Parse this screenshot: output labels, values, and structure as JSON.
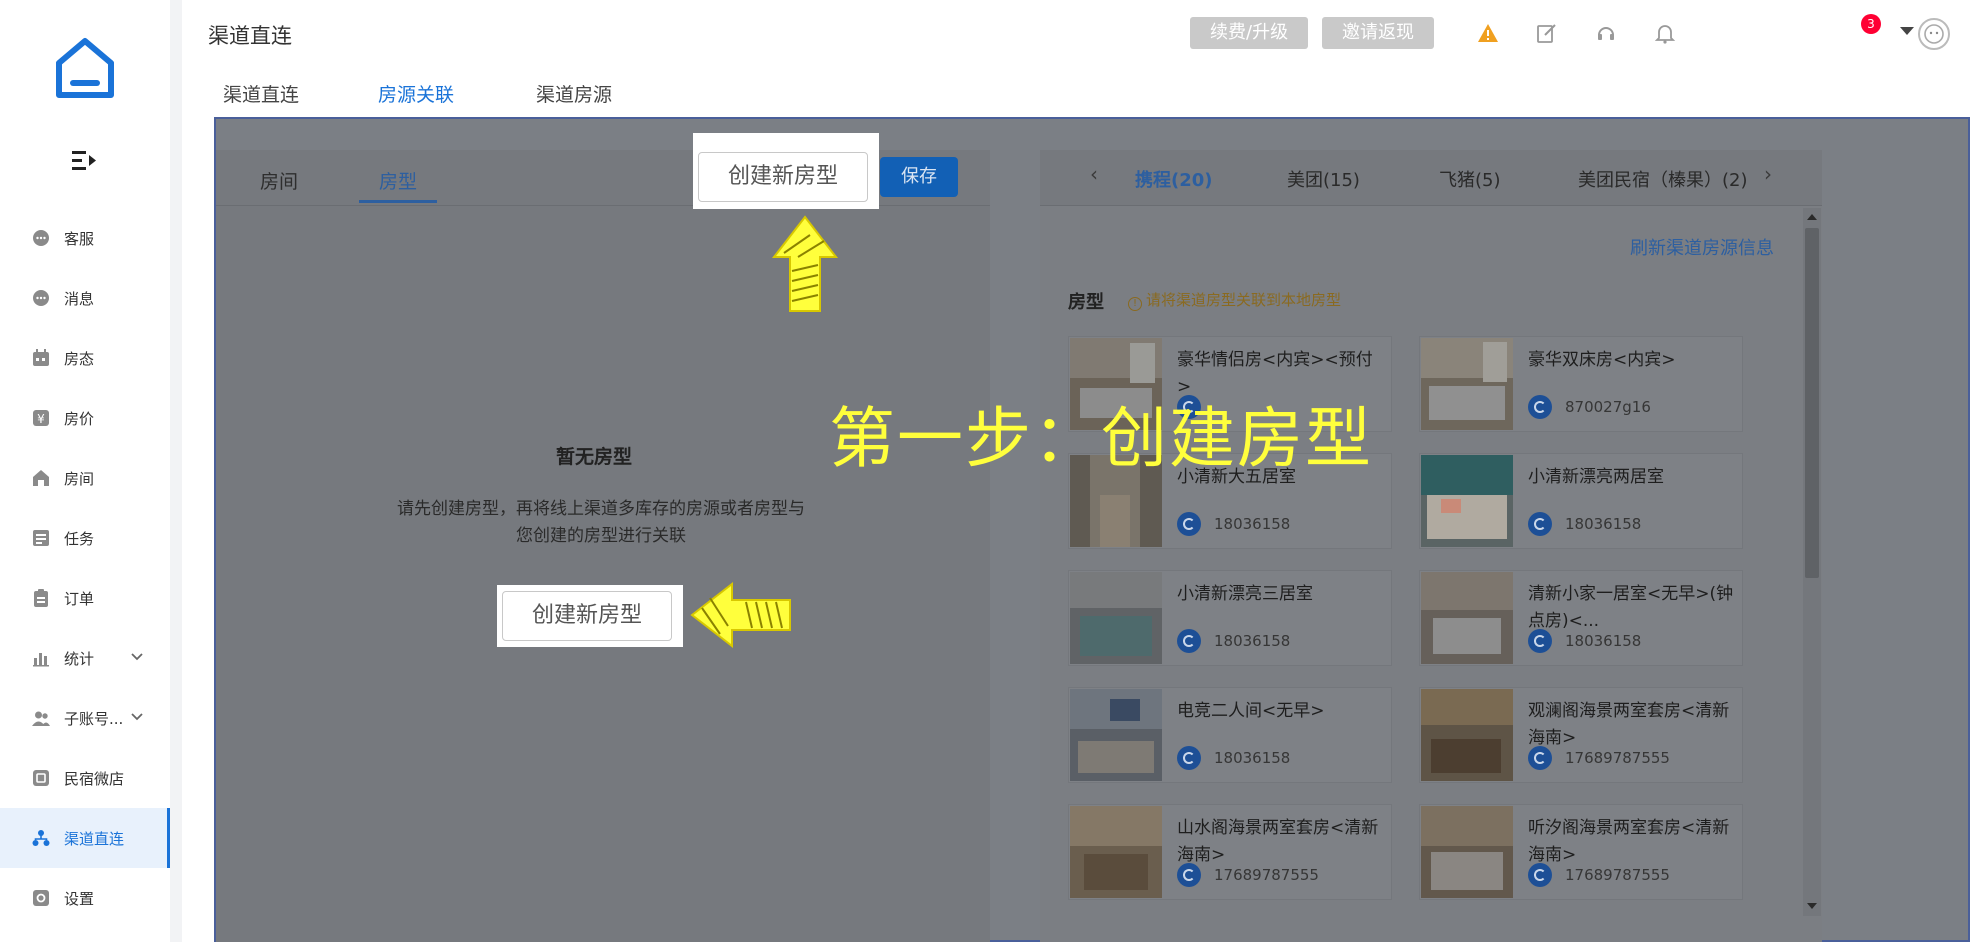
{
  "header": {
    "title": "渠道直连",
    "tabs": [
      {
        "label": "渠道直连",
        "active": false
      },
      {
        "label": "房源关联",
        "active": true
      },
      {
        "label": "渠道房源",
        "active": false
      }
    ],
    "renew_label": "续费/升级",
    "invite_label": "邀请返现",
    "notification_count": "3"
  },
  "sidebar": {
    "items": [
      {
        "label": "客服",
        "icon": "chat-icon"
      },
      {
        "label": "消息",
        "icon": "message-icon"
      },
      {
        "label": "房态",
        "icon": "calendar-icon"
      },
      {
        "label": "房价",
        "icon": "yen-icon"
      },
      {
        "label": "房间",
        "icon": "home-icon"
      },
      {
        "label": "任务",
        "icon": "task-icon"
      },
      {
        "label": "订单",
        "icon": "order-icon"
      },
      {
        "label": "统计",
        "icon": "chart-icon"
      },
      {
        "label": "子账号...",
        "icon": "users-icon"
      },
      {
        "label": "民宿微店",
        "icon": "shop-icon"
      },
      {
        "label": "渠道直连",
        "icon": "channel-icon",
        "active": true
      },
      {
        "label": "设置",
        "icon": "settings-icon"
      }
    ]
  },
  "left_panel": {
    "tabs": [
      {
        "label": "房间",
        "active": false
      },
      {
        "label": "房型",
        "active": true
      }
    ],
    "create_label": "创建新房型",
    "save_label": "保存",
    "empty_title": "暂无房型",
    "empty_desc": "请先创建房型，再将线上渠道多库存的房源或者房型与您创建的房型进行关联",
    "empty_create_label": "创建新房型"
  },
  "right_panel": {
    "tabs": [
      {
        "label": "携程(20)",
        "active": true
      },
      {
        "label": "美团(15)",
        "active": false
      },
      {
        "label": "飞猪(5)",
        "active": false
      },
      {
        "label": "美团民宿（榛果）(2)",
        "active": false
      }
    ],
    "prev_arrow": "‹",
    "next_arrow": "›",
    "refresh_label": "刷新渠道房源信息",
    "room_type_label": "房型",
    "hint": "请将渠道房型关联到本地房型",
    "rooms": [
      {
        "title": "豪华情侣房<内宾><预付>",
        "id": ""
      },
      {
        "title": "豪华双床房<内宾>",
        "id": "870027g16"
      },
      {
        "title": "小清新大五居室",
        "id": "18036158"
      },
      {
        "title": "小清新漂亮两居室",
        "id": "18036158"
      },
      {
        "title": "小清新漂亮三居室",
        "id": "18036158"
      },
      {
        "title": "清新小家一居室<无早>(钟点房)<...",
        "id": "18036158"
      },
      {
        "title": "电竞二人间<无早>",
        "id": "18036158"
      },
      {
        "title": "观澜阁海景两室套房<清新海南>",
        "id": "17689787555"
      },
      {
        "title": "山水阁海景两室套房<清新海南>",
        "id": "17689787555"
      },
      {
        "title": "听汐阁海景两室套房<清新海南>",
        "id": "17689787555"
      }
    ]
  },
  "annotation": {
    "step_text": "第一步：创建房型"
  },
  "colors": {
    "accent": "#1a73d8",
    "overlay": "#7b7f85",
    "annotation": "#ffff3c"
  }
}
